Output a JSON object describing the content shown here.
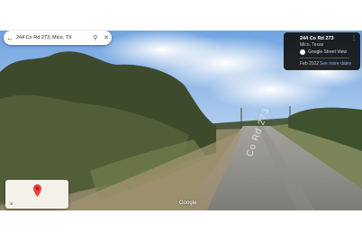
{
  "search": {
    "query": "244 Co Rd 273, Mico, TX"
  },
  "info_card": {
    "title": "244 Co Rd 273",
    "subtitle": "Mico, Texas",
    "source": "Google Street View",
    "date": "Feb 2022",
    "more_dates_label": "See more dates"
  },
  "road_text": "Co Rd 273",
  "watermark": "Google",
  "icons": [
    "back-arrow-icon",
    "search-icon",
    "close-icon",
    "pin-icon",
    "expand-icon",
    "street-view-icon"
  ]
}
